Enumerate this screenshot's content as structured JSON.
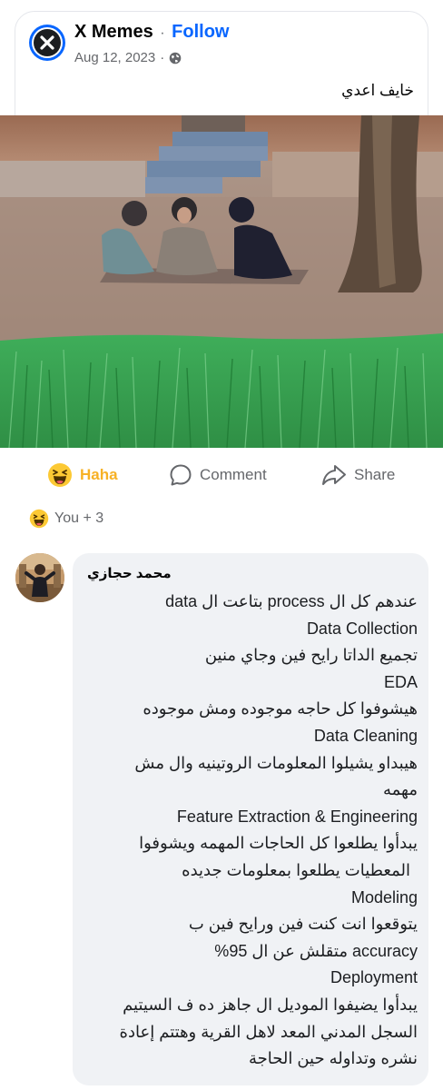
{
  "post": {
    "page_name": "X Memes",
    "separator": "·",
    "follow_label": "Follow",
    "date": "Aug 12, 2023",
    "date_separator": "·",
    "caption": "خايف اعدي",
    "icon": "globe-icon"
  },
  "actions": {
    "haha_label": "Haha",
    "comment_label": "Comment",
    "share_label": "Share"
  },
  "reactions": {
    "summary": "You + 3",
    "icon": "haha-emoji-icon"
  },
  "comment": {
    "author": "محمد حجازي",
    "lines": [
      "عندهم كل ال process بتاعت ال data",
      "Data Collection",
      "تجميع الداتا رايح فين وجاي منين",
      "EDA",
      "هيشوفوا كل حاجه موجوده ومش موجوده",
      "Data Cleaning",
      "هيبداو يشيلوا المعلومات الروتينيه وال مش",
      "مهمه",
      "Feature Extraction & Engineering",
      "يبدأوا يطلعوا كل الحاجات المهمه ويشوفوا",
      "المعطيات يطلعوا بمعلومات جديده",
      "Modeling",
      "يتوقعوا انت كنت فين ورايح فين ب",
      "accuracy متقلش عن ال 95%",
      "Deployment",
      "يبدأوا يضيفوا الموديل ال جاهز ده ف السيتيم",
      "السجل المدني المعد لاهل القرية وهتتم إعادة",
      "نشره وتداوله حين الحاجة"
    ]
  },
  "colors": {
    "brand_blue": "#0866ff",
    "haha_yellow": "#f7b125",
    "secondary_text": "#65676b",
    "bubble_bg": "#f0f2f5"
  }
}
